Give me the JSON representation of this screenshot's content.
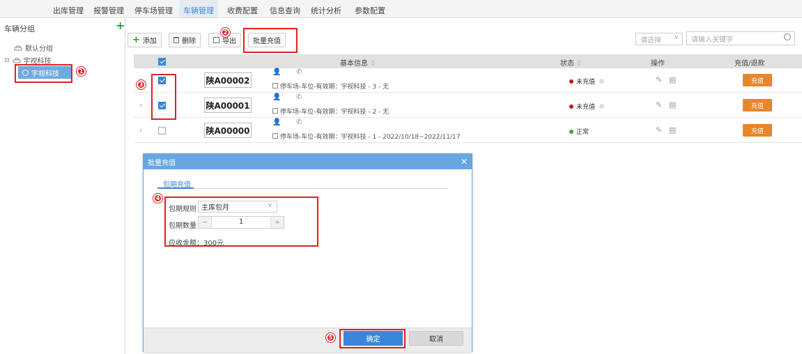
{
  "nav": {
    "items": [
      "出库管理",
      "报警管理",
      "停车场管理",
      "车辆管理",
      "收费配置",
      "信息查询",
      "统计分析",
      "参数配置"
    ],
    "active_index": 3
  },
  "sidebar": {
    "title": "车辆分组",
    "add_icon": "plus-icon",
    "groups": [
      {
        "label": "默认分组",
        "icon": "car-icon"
      },
      {
        "label": "宇视科技",
        "icon": "car-icon",
        "expanded": true
      }
    ],
    "selected_item": "宇视科技"
  },
  "toolbar": {
    "add_label": "添加",
    "delete_label": "删除",
    "export_label": "导出",
    "batch_recharge_label": "批量充值",
    "filter_placeholder": "请选择",
    "search_placeholder": "请输入关键字"
  },
  "table": {
    "headers": {
      "basic_info": "基本信息",
      "status": "状态",
      "actions": "操作",
      "recharge": "充值/退款"
    },
    "validity_label": "停车场-车位-有效期：",
    "rows": [
      {
        "plate": "陕A00002",
        "validity": "宇视科技 - 3 - 无",
        "status": "未充值",
        "status_color": "#c0161f",
        "checked": true
      },
      {
        "plate": "陕A00001",
        "validity": "宇视科技 - 2 - 无",
        "status": "未充值",
        "status_color": "#c0161f",
        "checked": true
      },
      {
        "plate": "陕A00000",
        "validity": "宇视科技 - 1 - 2022/10/18~2022/11/17",
        "status": "正常",
        "status_color": "#3aa83a",
        "checked": false
      }
    ],
    "recharge_button_label": "充值"
  },
  "dialog": {
    "title": "批量充值",
    "tab_label": "包期充值",
    "rule_label": "包期规则：",
    "rule_value": "主库包月",
    "count_label": "包期数量：",
    "count_value": "1",
    "stepper_minus": "−",
    "stepper_plus": "+",
    "amount_label": "应收金额：",
    "amount_value": "300元",
    "confirm_label": "确定",
    "cancel_label": "取消"
  },
  "annotations": [
    "1",
    "2",
    "3",
    "4",
    "5"
  ],
  "colors": {
    "accent": "#3a86d8",
    "dialog_header": "#6aa6e2",
    "recharge_button": "#e8862a",
    "highlight": "#e02020"
  }
}
